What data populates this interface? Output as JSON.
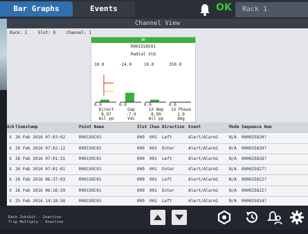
{
  "tabs": [
    {
      "label": "Bar Graphs",
      "active": true
    },
    {
      "label": "Events",
      "active": false
    }
  ],
  "header": {
    "status": "OK",
    "rack_title": "Rack 1",
    "status_color": "#35c935"
  },
  "view_title": "Channel View",
  "info": {
    "rack": "Rack: 1",
    "slot": "Slot: 9",
    "channel": "Channel: 1"
  },
  "card": {
    "status": "OK",
    "point_name": "R0015S9C01",
    "category": "Radial Vib",
    "bar_color": "#3cb03c",
    "columns": [
      {
        "top": "10.0",
        "bottom": "0.0",
        "label": "Direct",
        "value": "8.97",
        "unit": "mil pp",
        "fill": 0.09
      },
      {
        "top": "-24.0",
        "bottom": "0.0",
        "label": "Gap",
        "value": "-7.0",
        "unit": "Vdc",
        "fill": 0.29
      },
      {
        "top": "10.0",
        "bottom": "0.0",
        "label": "1X Amp",
        "value": "8.99",
        "unit": "mil pp",
        "fill": 0.09
      },
      {
        "top": "359.0",
        "bottom": "0.0",
        "label": "1X Phase",
        "value": "1.0",
        "unit": "deg",
        "fill": 0.0
      }
    ]
  },
  "table": {
    "headers": [
      "Ack",
      "Timestamp",
      "Point Name",
      "Slot",
      "Chan",
      "Direction",
      "Event",
      "Mode",
      "Sequence Num"
    ],
    "rows": [
      [
        "X",
        "26 Feb  2016 07:03:02",
        "R001S9C01",
        "009",
        "001",
        "Left",
        "Alert/Alarm1",
        "N/A",
        "000025820?"
      ],
      [
        "X",
        "26 Feb  2016 07:02:12",
        "R001S9C01",
        "009",
        "001",
        "Enter",
        "Alert/Alarm1",
        "N/A",
        "000025820?"
      ],
      [
        "X",
        "26 Feb  2016 07:01:31",
        "R001S9C01",
        "009",
        "001",
        "Left",
        "Alert/Alarm1",
        "N/A",
        "000025828?"
      ],
      [
        "X",
        "26 Feb  2016 07:01:01",
        "R001S9C01",
        "009",
        "001",
        "Enter",
        "Alert/Alarm1",
        "N/A",
        "000025827?"
      ],
      [
        "X",
        "26 Feb  2016 06:37:03",
        "R001S9C01",
        "009",
        "001",
        "Left",
        "Alert/Alarm1",
        "N/A",
        "000025822?"
      ],
      [
        "X",
        "26 Feb  2016 06:36:59",
        "R001S9C01",
        "009",
        "001",
        "Enter",
        "Alert/Alarm1",
        "N/A",
        "000025822?"
      ],
      [
        "X",
        "25 Feb  2016 14:18:58",
        "R001S9C01",
        "009",
        "001",
        "Left",
        "Alert/Alarm1",
        "N/A",
        "000025814?"
      ]
    ]
  },
  "status": {
    "rack_inhibit": "Rack Inhibit  - Inactive",
    "trip_multiply": "Trip Multiply - Inactive"
  },
  "icons": [
    "bell-icon",
    "up-arrow-icon",
    "down-arrow-icon",
    "settings-hex-icon",
    "history-icon",
    "alarm-user-icon",
    "gear-icon"
  ]
}
